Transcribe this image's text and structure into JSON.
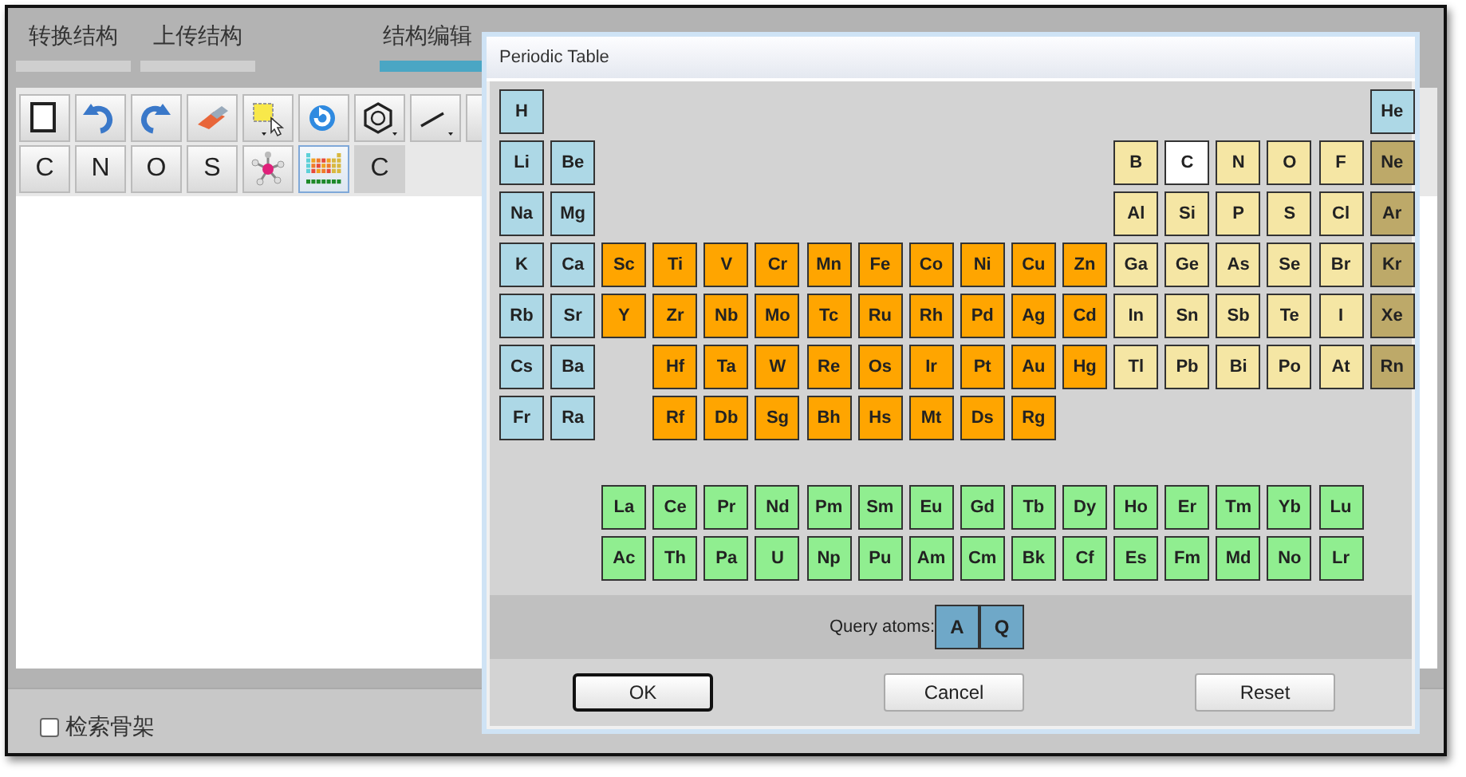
{
  "tabs": [
    {
      "label": "转换结构",
      "selected": false
    },
    {
      "label": "上传结构",
      "selected": false
    },
    {
      "label": "结构编辑",
      "selected": true
    }
  ],
  "atom_toolbar": [
    {
      "kind": "text",
      "label": "C",
      "selected": false
    },
    {
      "kind": "text",
      "label": "N",
      "selected": false
    },
    {
      "kind": "text",
      "label": "O",
      "selected": false
    },
    {
      "kind": "text",
      "label": "S",
      "selected": false
    },
    {
      "kind": "icon",
      "selected": false
    },
    {
      "kind": "icon",
      "selected": true
    },
    {
      "kind": "current",
      "label": "C",
      "selected": false
    }
  ],
  "scaffold_search": {
    "label": "检索骨架",
    "checked": false
  },
  "dialog": {
    "title": "Periodic Table",
    "periods": [
      [
        {
          "symbol": "H",
          "kind": "s",
          "selected": false
        },
        {
          "symbol": "He",
          "kind": "helium",
          "selected": false
        }
      ],
      [
        {
          "symbol": "Li",
          "kind": "s",
          "selected": false
        },
        {
          "symbol": "Be",
          "kind": "s",
          "selected": false
        },
        {
          "symbol": "B",
          "kind": "p",
          "selected": false
        },
        {
          "symbol": "C",
          "kind": "p",
          "selected": true
        },
        {
          "symbol": "N",
          "kind": "p",
          "selected": false
        },
        {
          "symbol": "O",
          "kind": "p",
          "selected": false
        },
        {
          "symbol": "F",
          "kind": "p",
          "selected": false
        },
        {
          "symbol": "Ne",
          "kind": "noble",
          "selected": false
        }
      ],
      [
        {
          "symbol": "Na",
          "kind": "s",
          "selected": false
        },
        {
          "symbol": "Mg",
          "kind": "s",
          "selected": false
        },
        {
          "symbol": "Al",
          "kind": "p",
          "selected": false
        },
        {
          "symbol": "Si",
          "kind": "p",
          "selected": false
        },
        {
          "symbol": "P",
          "kind": "p",
          "selected": false
        },
        {
          "symbol": "S",
          "kind": "p",
          "selected": false
        },
        {
          "symbol": "Cl",
          "kind": "p",
          "selected": false
        },
        {
          "symbol": "Ar",
          "kind": "noble",
          "selected": false
        }
      ],
      [
        {
          "symbol": "K",
          "kind": "s",
          "selected": false
        },
        {
          "symbol": "Ca",
          "kind": "s",
          "selected": false
        },
        {
          "symbol": "Sc",
          "kind": "d",
          "selected": false
        },
        {
          "symbol": "Ti",
          "kind": "d",
          "selected": false
        },
        {
          "symbol": "V",
          "kind": "d",
          "selected": false
        },
        {
          "symbol": "Cr",
          "kind": "d",
          "selected": false
        },
        {
          "symbol": "Mn",
          "kind": "d",
          "selected": false
        },
        {
          "symbol": "Fe",
          "kind": "d",
          "selected": false
        },
        {
          "symbol": "Co",
          "kind": "d",
          "selected": false
        },
        {
          "symbol": "Ni",
          "kind": "d",
          "selected": false
        },
        {
          "symbol": "Cu",
          "kind": "d",
          "selected": false
        },
        {
          "symbol": "Zn",
          "kind": "d",
          "selected": false
        },
        {
          "symbol": "Ga",
          "kind": "p",
          "selected": false
        },
        {
          "symbol": "Ge",
          "kind": "p",
          "selected": false
        },
        {
          "symbol": "As",
          "kind": "p",
          "selected": false
        },
        {
          "symbol": "Se",
          "kind": "p",
          "selected": false
        },
        {
          "symbol": "Br",
          "kind": "p",
          "selected": false
        },
        {
          "symbol": "Kr",
          "kind": "noble",
          "selected": false
        }
      ],
      [
        {
          "symbol": "Rb",
          "kind": "s",
          "selected": false
        },
        {
          "symbol": "Sr",
          "kind": "s",
          "selected": false
        },
        {
          "symbol": "Y",
          "kind": "d",
          "selected": false
        },
        {
          "symbol": "Zr",
          "kind": "d",
          "selected": false
        },
        {
          "symbol": "Nb",
          "kind": "d",
          "selected": false
        },
        {
          "symbol": "Mo",
          "kind": "d",
          "selected": false
        },
        {
          "symbol": "Tc",
          "kind": "d",
          "selected": false
        },
        {
          "symbol": "Ru",
          "kind": "d",
          "selected": false
        },
        {
          "symbol": "Rh",
          "kind": "d",
          "selected": false
        },
        {
          "symbol": "Pd",
          "kind": "d",
          "selected": false
        },
        {
          "symbol": "Ag",
          "kind": "d",
          "selected": false
        },
        {
          "symbol": "Cd",
          "kind": "d",
          "selected": false
        },
        {
          "symbol": "In",
          "kind": "p",
          "selected": false
        },
        {
          "symbol": "Sn",
          "kind": "p",
          "selected": false
        },
        {
          "symbol": "Sb",
          "kind": "p",
          "selected": false
        },
        {
          "symbol": "Te",
          "kind": "p",
          "selected": false
        },
        {
          "symbol": "I",
          "kind": "p",
          "selected": false
        },
        {
          "symbol": "Xe",
          "kind": "noble",
          "selected": false
        }
      ],
      [
        {
          "symbol": "Cs",
          "kind": "s",
          "selected": false
        },
        {
          "symbol": "Ba",
          "kind": "s",
          "selected": false
        },
        {
          "symbol": "Hf",
          "kind": "d",
          "selected": false
        },
        {
          "symbol": "Ta",
          "kind": "d",
          "selected": false
        },
        {
          "symbol": "W",
          "kind": "d",
          "selected": false
        },
        {
          "symbol": "Re",
          "kind": "d",
          "selected": false
        },
        {
          "symbol": "Os",
          "kind": "d",
          "selected": false
        },
        {
          "symbol": "Ir",
          "kind": "d",
          "selected": false
        },
        {
          "symbol": "Pt",
          "kind": "d",
          "selected": false
        },
        {
          "symbol": "Au",
          "kind": "d",
          "selected": false
        },
        {
          "symbol": "Hg",
          "kind": "d",
          "selected": false
        },
        {
          "symbol": "Tl",
          "kind": "p",
          "selected": false
        },
        {
          "symbol": "Pb",
          "kind": "p",
          "selected": false
        },
        {
          "symbol": "Bi",
          "kind": "p",
          "selected": false
        },
        {
          "symbol": "Po",
          "kind": "p",
          "selected": false
        },
        {
          "symbol": "At",
          "kind": "p",
          "selected": false
        },
        {
          "symbol": "Rn",
          "kind": "noble",
          "selected": false
        }
      ],
      [
        {
          "symbol": "Fr",
          "kind": "s",
          "selected": false
        },
        {
          "symbol": "Ra",
          "kind": "s",
          "selected": false
        },
        {
          "symbol": "Rf",
          "kind": "d",
          "selected": false
        },
        {
          "symbol": "Db",
          "kind": "d",
          "selected": false
        },
        {
          "symbol": "Sg",
          "kind": "d",
          "selected": false
        },
        {
          "symbol": "Bh",
          "kind": "d",
          "selected": false
        },
        {
          "symbol": "Hs",
          "kind": "d",
          "selected": false
        },
        {
          "symbol": "Mt",
          "kind": "d",
          "selected": false
        },
        {
          "symbol": "Ds",
          "kind": "d",
          "selected": false
        },
        {
          "symbol": "Rg",
          "kind": "d",
          "selected": false
        }
      ]
    ],
    "f_block": [
      [
        {
          "symbol": "La",
          "kind": "f",
          "selected": false
        },
        {
          "symbol": "Ce",
          "kind": "f",
          "selected": false
        },
        {
          "symbol": "Pr",
          "kind": "f",
          "selected": false
        },
        {
          "symbol": "Nd",
          "kind": "f",
          "selected": false
        },
        {
          "symbol": "Pm",
          "kind": "f",
          "selected": false
        },
        {
          "symbol": "Sm",
          "kind": "f",
          "selected": false
        },
        {
          "symbol": "Eu",
          "kind": "f",
          "selected": false
        },
        {
          "symbol": "Gd",
          "kind": "f",
          "selected": false
        },
        {
          "symbol": "Tb",
          "kind": "f",
          "selected": false
        },
        {
          "symbol": "Dy",
          "kind": "f",
          "selected": false
        },
        {
          "symbol": "Ho",
          "kind": "f",
          "selected": false
        },
        {
          "symbol": "Er",
          "kind": "f",
          "selected": false
        },
        {
          "symbol": "Tm",
          "kind": "f",
          "selected": false
        },
        {
          "symbol": "Yb",
          "kind": "f",
          "selected": false
        },
        {
          "symbol": "Lu",
          "kind": "f",
          "selected": false
        }
      ],
      [
        {
          "symbol": "Ac",
          "kind": "f",
          "selected": false
        },
        {
          "symbol": "Th",
          "kind": "f",
          "selected": false
        },
        {
          "symbol": "Pa",
          "kind": "f",
          "selected": false
        },
        {
          "symbol": "U",
          "kind": "f",
          "selected": false
        },
        {
          "symbol": "Np",
          "kind": "f",
          "selected": false
        },
        {
          "symbol": "Pu",
          "kind": "f",
          "selected": false
        },
        {
          "symbol": "Am",
          "kind": "f",
          "selected": false
        },
        {
          "symbol": "Cm",
          "kind": "f",
          "selected": false
        },
        {
          "symbol": "Bk",
          "kind": "f",
          "selected": false
        },
        {
          "symbol": "Cf",
          "kind": "f",
          "selected": false
        },
        {
          "symbol": "Es",
          "kind": "f",
          "selected": false
        },
        {
          "symbol": "Fm",
          "kind": "f",
          "selected": false
        },
        {
          "symbol": "Md",
          "kind": "f",
          "selected": false
        },
        {
          "symbol": "No",
          "kind": "f",
          "selected": false
        },
        {
          "symbol": "Lr",
          "kind": "f",
          "selected": false
        }
      ]
    ],
    "query_label": "Query atoms:",
    "query_atoms": [
      {
        "symbol": "A",
        "selected": false
      },
      {
        "symbol": "Q",
        "selected": false
      }
    ],
    "buttons": [
      {
        "label": "OK",
        "focused": true
      },
      {
        "label": "Cancel",
        "focused": false
      },
      {
        "label": "Reset",
        "focused": false
      }
    ]
  }
}
